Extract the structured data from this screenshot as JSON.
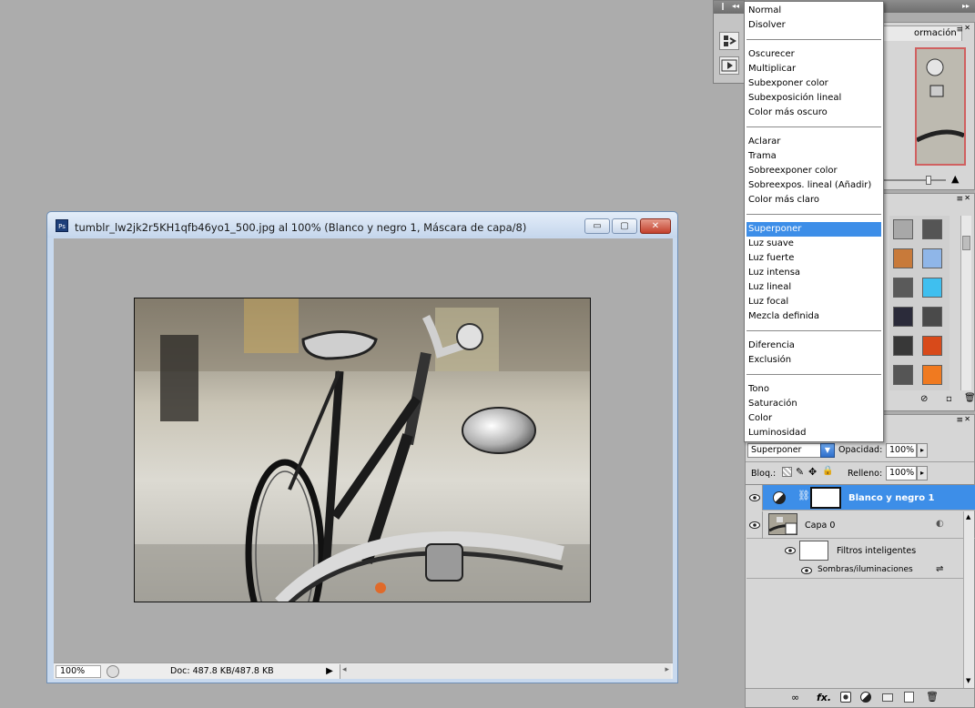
{
  "document": {
    "title": "tumblr_lw2jk2r5KH1qfb46yo1_500.jpg al 100% (Blanco y negro 1, Máscara de capa/8)",
    "app_icon": "Ps",
    "zoom": "100%",
    "doc_info": "Doc: 487.8 KB/487.8 KB",
    "window_controls": {
      "minimize": "▭",
      "maximize": "▢",
      "close": "✕"
    }
  },
  "blend_menu": {
    "groups": [
      [
        "Normal",
        "Disolver"
      ],
      [
        "Oscurecer",
        "Multiplicar",
        "Subexponer color",
        "Subexposición lineal",
        "Color más oscuro"
      ],
      [
        "Aclarar",
        "Trama",
        "Sobreexponer color",
        "Sobreexpos. lineal (Añadir)",
        "Color más claro"
      ],
      [
        "Superponer",
        "Luz suave",
        "Luz fuerte",
        "Luz intensa",
        "Luz lineal",
        "Luz focal",
        "Mezcla definida"
      ],
      [
        "Diferencia",
        "Exclusión"
      ],
      [
        "Tono",
        "Saturación",
        "Color",
        "Luminosidad"
      ]
    ],
    "selected": "Superponer"
  },
  "navigator": {
    "tab_partial": "ormación"
  },
  "layers": {
    "blend_mode": "Superponer",
    "opacity_label": "Opacidad:",
    "opacity_value": "100%",
    "lock_label": "Bloq.:",
    "fill_label": "Relleno:",
    "fill_value": "100%",
    "items": [
      {
        "name": "Blanco y negro 1",
        "selected": true
      },
      {
        "name": "Capa 0",
        "selected": false
      }
    ],
    "smart_filters_label": "Filtros inteligentes",
    "filter_name": "Sombras/iluminaciones",
    "footer_icons": [
      "link-icon",
      "fx-icon",
      "mask-icon",
      "adjustment-icon",
      "folder-icon",
      "new-layer-icon",
      "trash-icon"
    ],
    "fx_label": "fx."
  },
  "styles_swatches": [
    "#a8a8a8",
    "#555555",
    "#c87a3a",
    "#8fb6e8",
    "#5a5a5a",
    "#3fbfef",
    "#2b2b3a",
    "#4a4a4a",
    "#383838",
    "#d84a1a",
    "#555555",
    "#f07a20"
  ],
  "colors": {
    "menu_selected": "#3d8ee8",
    "layer_selected": "#3d8ee8",
    "panel_bg": "#d6d6d6",
    "workspace_bg": "#acacac"
  }
}
